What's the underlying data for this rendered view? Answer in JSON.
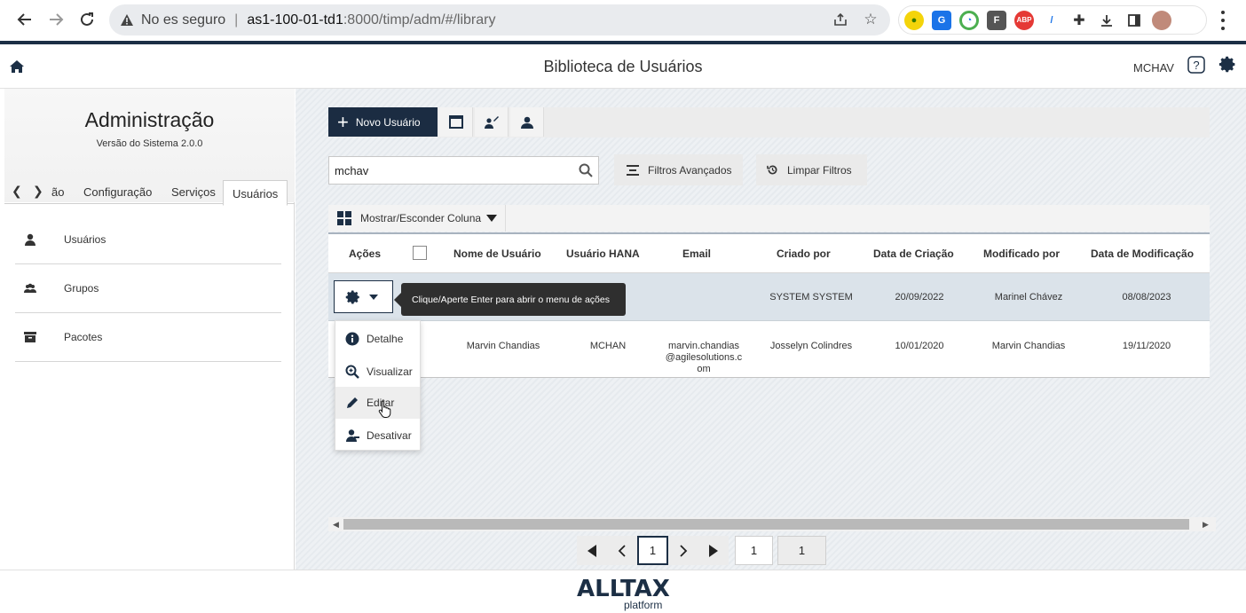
{
  "browser": {
    "security_label": "No es seguro",
    "url_host": "as1-100-01-td1",
    "url_path": ":8000/timp/adm/#/library"
  },
  "header": {
    "title": "Biblioteca de Usuários",
    "user": "MCHAV"
  },
  "sidebar": {
    "title": "Administração",
    "version": "Versão do Sistema 2.0.0",
    "tabs": [
      "ão",
      "Configuração",
      "Serviços",
      "Usuários"
    ],
    "active_tab": "Usuários",
    "items": [
      {
        "label": "Usuários",
        "icon": "user-icon"
      },
      {
        "label": "Grupos",
        "icon": "group-icon"
      },
      {
        "label": "Pacotes",
        "icon": "package-icon"
      }
    ]
  },
  "toolbar": {
    "new_user_label": "Novo Usuário"
  },
  "search": {
    "value": "mchav"
  },
  "filters": {
    "advanced_label": "Filtros Avançados",
    "clear_label": "Limpar Filtros"
  },
  "grid": {
    "column_toggle_label": "Mostrar/Esconder Coluna",
    "columns": [
      "Ações",
      "Nome de Usuário",
      "Usuário HANA",
      "Email",
      "Criado por",
      "Data de Criação",
      "Modificado por",
      "Data de Modificação"
    ],
    "rows": [
      {
        "name": "",
        "hana": "",
        "email": "",
        "created_by": "SYSTEM SYSTEM",
        "created_at": "20/09/2022",
        "modified_by": "Marinel Chávez",
        "modified_at": "08/08/2023"
      },
      {
        "name": "Marvin Chandias",
        "hana": "MCHAN",
        "email_l1": "marvin.chandias",
        "email_l2": "@agilesolutions.c",
        "email_l3": "om",
        "created_by": "Josselyn Colindres",
        "created_at": "10/01/2020",
        "modified_by": "Marvin Chandias",
        "modified_at": "19/11/2020"
      }
    ]
  },
  "tooltip": {
    "text": "Clique/Aperte Enter para abrir o menu de ações"
  },
  "action_menu": {
    "items": [
      "Detalhe",
      "Visualizar",
      "Editar",
      "Desativar"
    ]
  },
  "pager": {
    "current_page": "1",
    "page_input": "1",
    "total_pages": "1"
  },
  "footer": {
    "logo": "ALLTAX",
    "logo_sub": "platform"
  }
}
